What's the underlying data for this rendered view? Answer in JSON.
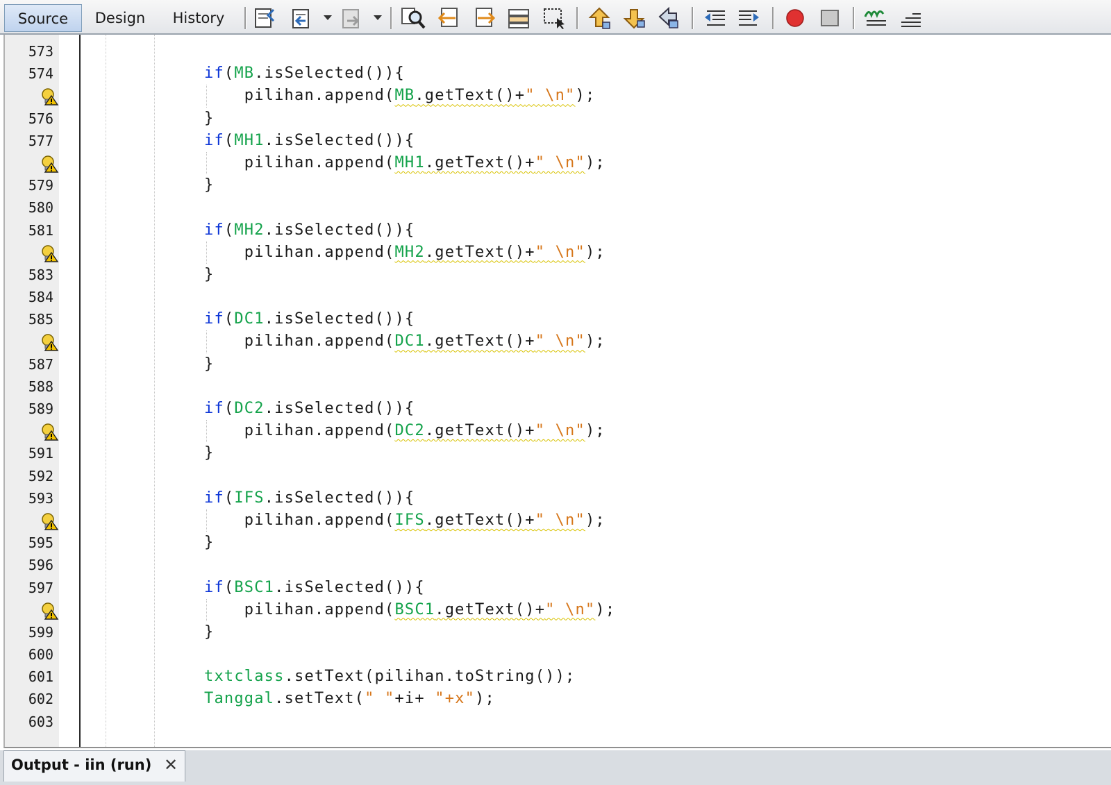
{
  "toolbar": {
    "tabs": [
      {
        "label": "Source",
        "active": true
      },
      {
        "label": "Design",
        "active": false
      },
      {
        "label": "History",
        "active": false
      }
    ]
  },
  "editor": {
    "lines": [
      {
        "number": "573",
        "hint": false,
        "code": []
      },
      {
        "number": "574",
        "hint": false,
        "code": [
          [
            "kw",
            "if"
          ],
          [
            "p",
            "("
          ],
          [
            "fld",
            "MB"
          ],
          [
            "p",
            ".isSelected()){"
          ]
        ]
      },
      {
        "number": "",
        "hint": true,
        "code": [
          [
            "p",
            "    pilihan.append("
          ],
          [
            "sq-fld",
            "MB"
          ],
          [
            "sq-p",
            ".getText()+"
          ],
          [
            "sq-str",
            "\" \\n\""
          ],
          [
            "p",
            ");"
          ]
        ]
      },
      {
        "number": "576",
        "hint": false,
        "code": [
          [
            "p",
            "}"
          ]
        ]
      },
      {
        "number": "577",
        "hint": false,
        "code": [
          [
            "kw",
            "if"
          ],
          [
            "p",
            "("
          ],
          [
            "fld",
            "MH1"
          ],
          [
            "p",
            ".isSelected()){"
          ]
        ]
      },
      {
        "number": "",
        "hint": true,
        "code": [
          [
            "p",
            "    pilihan.append("
          ],
          [
            "sq-fld",
            "MH1"
          ],
          [
            "sq-p",
            ".getText()+"
          ],
          [
            "sq-str",
            "\" \\n\""
          ],
          [
            "p",
            ");"
          ]
        ]
      },
      {
        "number": "579",
        "hint": false,
        "code": [
          [
            "p",
            "}"
          ]
        ]
      },
      {
        "number": "580",
        "hint": false,
        "code": []
      },
      {
        "number": "581",
        "hint": false,
        "code": [
          [
            "kw",
            "if"
          ],
          [
            "p",
            "("
          ],
          [
            "fld",
            "MH2"
          ],
          [
            "p",
            ".isSelected()){"
          ]
        ]
      },
      {
        "number": "",
        "hint": true,
        "code": [
          [
            "p",
            "    pilihan.append("
          ],
          [
            "sq-fld",
            "MH2"
          ],
          [
            "sq-p",
            ".getText()+"
          ],
          [
            "sq-str",
            "\" \\n\""
          ],
          [
            "p",
            ");"
          ]
        ]
      },
      {
        "number": "583",
        "hint": false,
        "code": [
          [
            "p",
            "}"
          ]
        ]
      },
      {
        "number": "584",
        "hint": false,
        "code": []
      },
      {
        "number": "585",
        "hint": false,
        "code": [
          [
            "kw",
            "if"
          ],
          [
            "p",
            "("
          ],
          [
            "fld",
            "DC1"
          ],
          [
            "p",
            ".isSelected()){"
          ]
        ]
      },
      {
        "number": "",
        "hint": true,
        "code": [
          [
            "p",
            "    pilihan.append("
          ],
          [
            "sq-fld",
            "DC1"
          ],
          [
            "sq-p",
            ".getText()+"
          ],
          [
            "sq-str",
            "\" \\n\""
          ],
          [
            "p",
            ");"
          ]
        ]
      },
      {
        "number": "587",
        "hint": false,
        "code": [
          [
            "p",
            "}"
          ]
        ]
      },
      {
        "number": "588",
        "hint": false,
        "code": []
      },
      {
        "number": "589",
        "hint": false,
        "code": [
          [
            "kw",
            "if"
          ],
          [
            "p",
            "("
          ],
          [
            "fld",
            "DC2"
          ],
          [
            "p",
            ".isSelected()){"
          ]
        ]
      },
      {
        "number": "",
        "hint": true,
        "code": [
          [
            "p",
            "    pilihan.append("
          ],
          [
            "sq-fld",
            "DC2"
          ],
          [
            "sq-p",
            ".getText()+"
          ],
          [
            "sq-str",
            "\" \\n\""
          ],
          [
            "p",
            ");"
          ]
        ]
      },
      {
        "number": "591",
        "hint": false,
        "code": [
          [
            "p",
            "}"
          ]
        ]
      },
      {
        "number": "592",
        "hint": false,
        "code": []
      },
      {
        "number": "593",
        "hint": false,
        "code": [
          [
            "kw",
            "if"
          ],
          [
            "p",
            "("
          ],
          [
            "fld",
            "IFS"
          ],
          [
            "p",
            ".isSelected()){"
          ]
        ]
      },
      {
        "number": "",
        "hint": true,
        "code": [
          [
            "p",
            "    pilihan.append("
          ],
          [
            "sq-fld",
            "IFS"
          ],
          [
            "sq-p",
            ".getText()+"
          ],
          [
            "sq-str",
            "\" \\n\""
          ],
          [
            "p",
            ");"
          ]
        ]
      },
      {
        "number": "595",
        "hint": false,
        "code": [
          [
            "p",
            "}"
          ]
        ]
      },
      {
        "number": "596",
        "hint": false,
        "code": []
      },
      {
        "number": "597",
        "hint": false,
        "code": [
          [
            "kw",
            "if"
          ],
          [
            "p",
            "("
          ],
          [
            "fld",
            "BSC1"
          ],
          [
            "p",
            ".isSelected()){"
          ]
        ]
      },
      {
        "number": "",
        "hint": true,
        "code": [
          [
            "p",
            "    pilihan.append("
          ],
          [
            "sq-fld",
            "BSC1"
          ],
          [
            "sq-p",
            ".getText()+"
          ],
          [
            "sq-str",
            "\" \\n\""
          ],
          [
            "p",
            ");"
          ]
        ]
      },
      {
        "number": "599",
        "hint": false,
        "code": [
          [
            "p",
            "}"
          ]
        ]
      },
      {
        "number": "600",
        "hint": false,
        "code": []
      },
      {
        "number": "601",
        "hint": false,
        "code": [
          [
            "fld",
            "txtclass"
          ],
          [
            "p",
            ".setText(pilihan.toString());"
          ]
        ]
      },
      {
        "number": "602",
        "hint": false,
        "code": [
          [
            "fld",
            "Tanggal"
          ],
          [
            "p",
            ".setText("
          ],
          [
            "str",
            "\" \""
          ],
          [
            "p",
            "+i+ "
          ],
          [
            "str",
            "\"+x\""
          ],
          [
            "p",
            ");"
          ]
        ]
      },
      {
        "number": "603",
        "hint": false,
        "code": []
      }
    ]
  },
  "output": {
    "tab_label": "Output - iin (run)",
    "close_glyph": "✕"
  },
  "colors": {
    "keyword": "#0a33d6",
    "field": "#13a24a",
    "string": "#d6761a",
    "squiggle": "#d8c200",
    "gutter": "#eeeeee"
  }
}
